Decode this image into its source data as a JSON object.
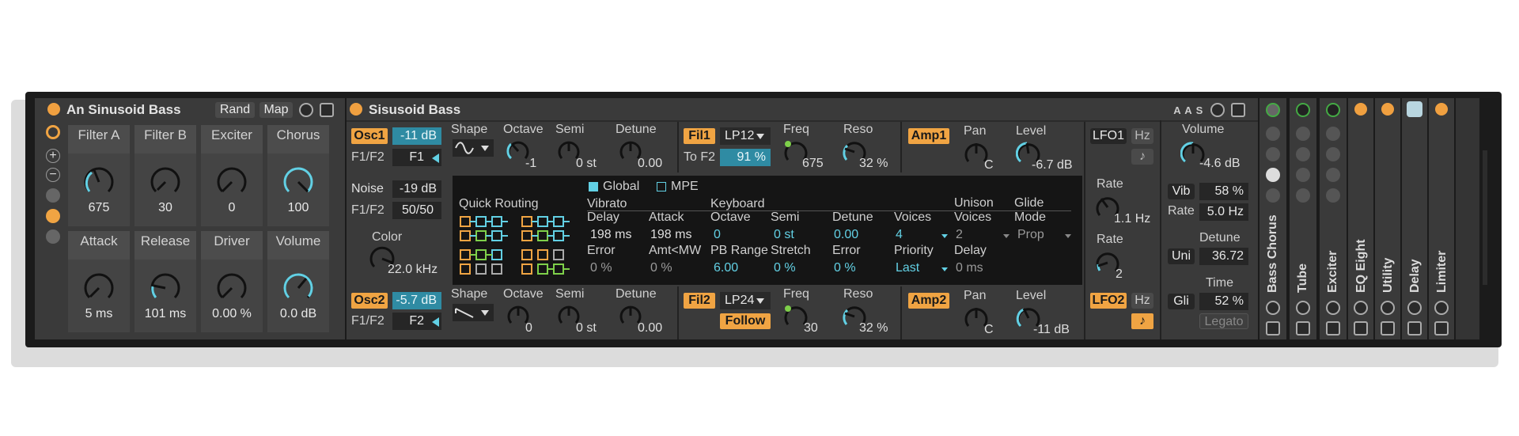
{
  "rack_title": "An Sinusoid Bass",
  "rack_rand": "Rand",
  "rack_map": "Map",
  "macros": [
    {
      "label": "Filter A",
      "value": "675"
    },
    {
      "label": "Filter B",
      "value": "30"
    },
    {
      "label": "Exciter",
      "value": "0"
    },
    {
      "label": "Chorus",
      "value": "100"
    },
    {
      "label": "Attack",
      "value": "5 ms"
    },
    {
      "label": "Release",
      "value": "101 ms"
    },
    {
      "label": "Driver",
      "value": "0.00 %"
    },
    {
      "label": "Volume",
      "value": "0.0 dB"
    }
  ],
  "synth_title": "Sisusoid Bass",
  "osc1": {
    "name": "Osc1",
    "level": "-11 dB",
    "f1f2_label": "F1/F2",
    "f1f2_value": "F1",
    "shape_label": "Shape",
    "octave_label": "Octave",
    "octave": "-1",
    "semi_label": "Semi",
    "semi": "0 st",
    "detune_label": "Detune",
    "detune": "0.00"
  },
  "noise": {
    "name": "Noise",
    "level": "-19 dB",
    "f1f2_label": "F1/F2",
    "f1f2_value": "50/50",
    "color_label": "Color",
    "color_value": "22.0 kHz"
  },
  "osc2": {
    "name": "Osc2",
    "level": "-5.7 dB",
    "f1f2_label": "F1/F2",
    "f1f2_value": "F2",
    "shape_label": "Shape",
    "octave_label": "Octave",
    "octave": "0",
    "semi_label": "Semi",
    "semi": "0 st",
    "detune_label": "Detune",
    "detune": "0.00"
  },
  "fil1": {
    "name": "Fil1",
    "type": "LP12",
    "to_label": "To F2",
    "to_value": "91 %",
    "freq_label": "Freq",
    "freq": "675",
    "reso_label": "Reso",
    "reso": "32 %"
  },
  "fil2": {
    "name": "Fil2",
    "type": "LP24",
    "follow": "Follow",
    "freq_label": "Freq",
    "freq": "30",
    "reso_label": "Reso",
    "reso": "32 %"
  },
  "amp1": {
    "name": "Amp1",
    "pan_label": "Pan",
    "pan": "C",
    "level_label": "Level",
    "level": "-6.7 dB"
  },
  "amp2": {
    "name": "Amp2",
    "pan_label": "Pan",
    "pan": "C",
    "level_label": "Level",
    "level": "-11 dB"
  },
  "matrix": {
    "global": "Global",
    "mpe": "MPE",
    "quick_routing": "Quick Routing",
    "vibrato": "Vibrato",
    "keyboard": "Keyboard",
    "delay_label": "Delay",
    "delay": "198 ms",
    "attack_label": "Attack",
    "attack": "198 ms",
    "octave_label": "Octave",
    "octave": "0",
    "semi_label": "Semi",
    "semi": "0 st",
    "detune_label": "Detune",
    "detune": "0.00",
    "voices_label": "Voices",
    "voices": "4",
    "unison_voices_label": "Unison Voices",
    "unison_voices": "2",
    "glide_mode_label": "Glide Mode",
    "glide_mode": "Prop",
    "error_label": "Error",
    "error": "0 %",
    "amtmw_label": "Amt<MW",
    "amtmw": "0 %",
    "pbrange_label": "PB Range",
    "pbrange": "6.00",
    "stretch_label": "Stretch",
    "stretch": "0 %",
    "error2_label": "Error",
    "error2": "0 %",
    "priority_label": "Priority",
    "priority": "Last",
    "udelay_label": "Delay",
    "udelay": "0 ms"
  },
  "lfo1": {
    "name": "LFO1",
    "hz": "Hz",
    "note": "♪",
    "rate_label": "Rate",
    "rate": "1.1 Hz"
  },
  "lfo2": {
    "name": "LFO2",
    "hz": "Hz",
    "note": "♪",
    "rate_label": "Rate",
    "rate": "2"
  },
  "global_section": {
    "header_a1": "A",
    "header_a2": "A",
    "header_s": "S",
    "volume_label": "Volume",
    "volume": "-4.6 dB",
    "vib_label": "Vib",
    "vib": "58 %",
    "rate_label": "Rate",
    "rate": "5.0 Hz",
    "detune_label": "Detune",
    "uni_label": "Uni",
    "detune": "36.72",
    "time_label": "Time",
    "gli_label": "Gli",
    "time": "52 %",
    "legato": "Legato"
  },
  "chain": [
    "Bass Chorus",
    "Tube",
    "Exciter",
    "EQ Eight",
    "Utility",
    "Delay",
    "Limiter"
  ],
  "colors": {
    "accent": "#f0a443",
    "cyan": "#62d0e4",
    "panel": "#3a3a3a"
  }
}
